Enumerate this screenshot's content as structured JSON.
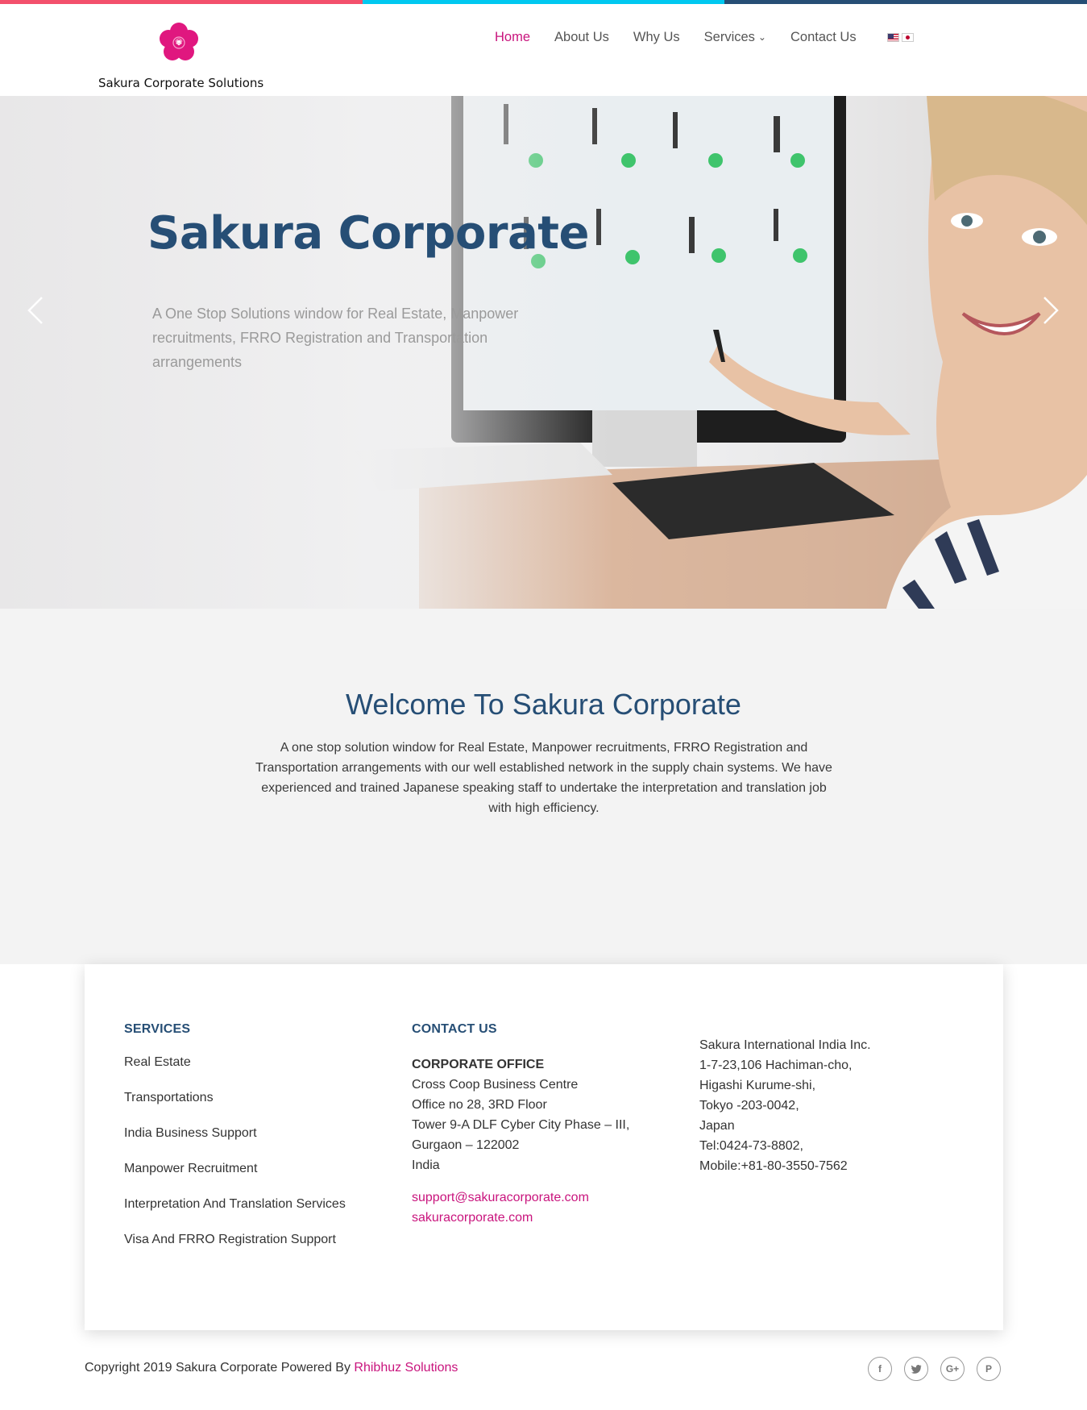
{
  "colors": {
    "accent_pink": "#c9147d",
    "navy": "#264e75",
    "top_bar": [
      "#f3506c",
      "#00c8f0",
      "#264e75"
    ]
  },
  "header": {
    "logo_text": "Sakura Corporate Solutions",
    "nav": [
      {
        "label": "Home",
        "active": true
      },
      {
        "label": "About Us"
      },
      {
        "label": "Why Us"
      },
      {
        "label": "Services",
        "has_dropdown": true
      },
      {
        "label": "Contact Us"
      }
    ],
    "languages": [
      "us-flag-icon",
      "japan-flag-icon"
    ]
  },
  "hero": {
    "title": "Sakura Corporate",
    "subtitle": "A One Stop Solutions window for Real Estate, Manpower recruitments, FRRO Registration and Transportation arrangements",
    "prev_icon": "chevron-left-icon",
    "next_icon": "chevron-right-icon"
  },
  "welcome": {
    "title": "Welcome To Sakura Corporate",
    "text": "A one stop solution window for Real Estate, Manpower recruitments, FRRO Registration and Transportation arrangements with our well established  network in the supply chain systems. We have experienced and trained Japanese speaking staff to undertake the interpretation and translation job with high efficiency."
  },
  "footer": {
    "services": {
      "heading": "SERVICES",
      "items": [
        "Real Estate",
        "Transportations",
        "India Business Support",
        "Manpower Recruitment",
        "Interpretation And Translation Services",
        "Visa And FRRO Registration Support"
      ]
    },
    "contact": {
      "heading": "CONTACT US",
      "office_heading": "CORPORATE OFFICE",
      "lines": [
        "Cross Coop Business Centre",
        "Office no 28, 3RD Floor",
        "Tower 9-A DLF Cyber City Phase – III,",
        "Gurgaon – 122002",
        "India"
      ],
      "email": "support@sakuracorporate.com",
      "website": "sakuracorporate.com"
    },
    "japan_address": [
      "Sakura International India Inc.",
      "1-7-23,106 Hachiman-cho,",
      "Higashi Kurume-shi,",
      "Tokyo -203-0042,",
      "Japan",
      "Tel:0424-73-8802,",
      "Mobile:+81-80-3550-7562"
    ]
  },
  "bottom": {
    "copyright_prefix": "Copyright 2019 Sakura Corporate Powered By ",
    "powered_by": "Rhibhuz Solutions",
    "social": [
      {
        "icon": "facebook-icon",
        "glyph": "f"
      },
      {
        "icon": "twitter-icon",
        "glyph": "t"
      },
      {
        "icon": "google-plus-icon",
        "glyph": "G+"
      },
      {
        "icon": "pinterest-icon",
        "glyph": "P"
      }
    ]
  }
}
